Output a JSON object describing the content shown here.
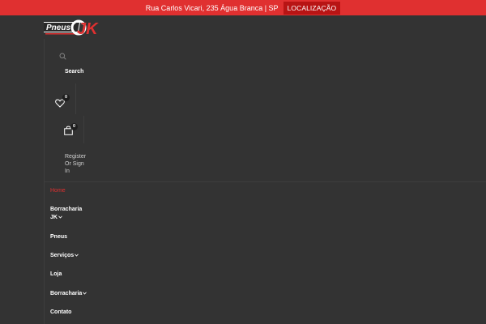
{
  "topbar": {
    "address": "Rua Carlos Vicari, 235 Água Branca | SP",
    "location_button": "LOCALIZAÇÃO",
    "bg_color": "#e03030",
    "button_color": "#b81414"
  },
  "logo": {
    "text": "Pneus",
    "mark": "JK",
    "accent": "#e03030"
  },
  "header": {
    "search_label": "Search",
    "wishlist_count": "0",
    "cart_count": "0",
    "register_line1": "Register",
    "register_line2": "Or Sign",
    "register_line3": "In"
  },
  "nav": {
    "home": "Home",
    "borracharia_jk_1": "Borracharia",
    "borracharia_jk_2": "JK",
    "pneus": "Pneus",
    "servicos": "Serviços",
    "loja": "Loja",
    "borracharia": "Borracharia",
    "contato": "Contato"
  },
  "icons": [
    "search-icon",
    "heart-icon",
    "shopping-bag-icon",
    "chevron-down-icon"
  ]
}
